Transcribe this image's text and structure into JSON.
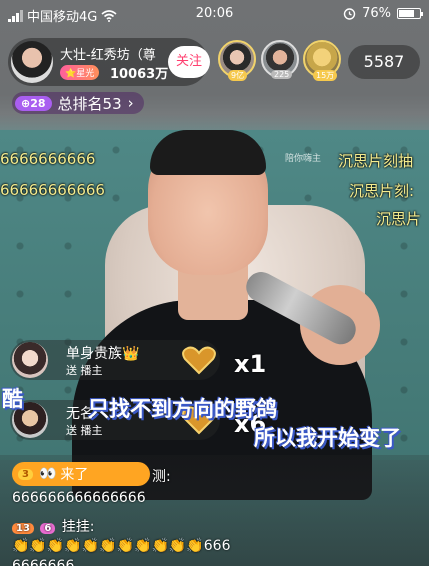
{
  "status_bar": {
    "carrier": "中国移动4G",
    "time": "20:06",
    "battery": "76%",
    "battery_level": 0.76
  },
  "host": {
    "name": "大壮-红秀坊（尊",
    "level": "⭐星光",
    "fans": "10063万",
    "follow_label": "关注"
  },
  "viewers": [
    {
      "badge": "9亿"
    },
    {
      "badge": "225"
    },
    {
      "badge": "15万"
    }
  ],
  "viewer_count": "5587",
  "rank": {
    "pill": "28",
    "label": "总排名53",
    "arrow": "›"
  },
  "watermark": "陪你嗨主",
  "danmaku": [
    "6666666666",
    "66666666666",
    "沉思片刻抽",
    "沉思片刻:",
    "沉思片"
  ],
  "gifts": [
    {
      "name": "单身贵族👑",
      "sub": "送  播主",
      "count": "x1"
    },
    {
      "name": "无名",
      "sub": "送  播主",
      "count": "x6"
    }
  ],
  "subtitles": {
    "line1_prefix": "酷",
    "line1": "只找不到方向的野鸽",
    "line2": "所以我开始变了"
  },
  "chat": {
    "welcome_level": "3",
    "welcome_text": "来了",
    "line1": "666666666666666",
    "line1_suffix": "测:",
    "line2_lvl1": "13",
    "line2_lvl2": "6",
    "line2_name": "挂挂:",
    "line3_claps": "👏👏👏👏👏👏👏👏👏👏👏",
    "line3_suffix": "666",
    "line4": "6666666"
  },
  "colors": {
    "danmaku": "#f4ec8e",
    "follow_text": "#ff3f6f",
    "rank_pill": "#a95ef0",
    "welcome_bg": "#ffa522"
  }
}
